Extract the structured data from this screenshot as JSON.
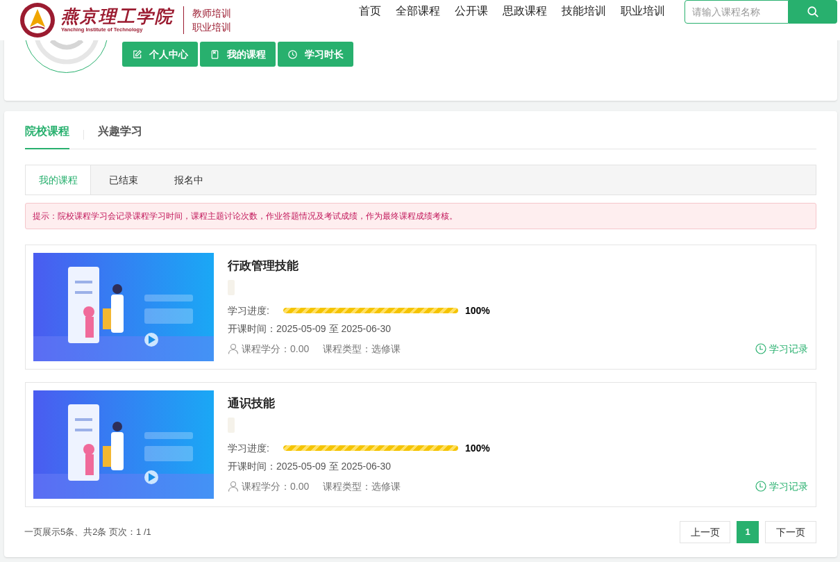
{
  "header": {
    "logo": {
      "name": "燕京理工学院",
      "subtitle": "Yanching Institute of Technology"
    },
    "site_labels": [
      "教师培训",
      "职业培训"
    ],
    "nav": [
      {
        "label": "首页",
        "selected": false
      },
      {
        "label": "全部课程",
        "selected": false
      },
      {
        "label": "公开课",
        "selected": false
      },
      {
        "label": "思政课程",
        "selected": false
      },
      {
        "label": "技能培训",
        "selected": false
      },
      {
        "label": "职业培训",
        "selected": false
      }
    ],
    "search": {
      "placeholder": "请输入课程名称"
    }
  },
  "profile": {
    "buttons": [
      {
        "label": "个人中心",
        "kind": "edit"
      },
      {
        "label": "我的课程",
        "kind": "book"
      },
      {
        "label": "学习时长",
        "kind": "clock"
      }
    ]
  },
  "tabs": [
    {
      "label": "院校课程",
      "selected": true
    },
    {
      "label": "兴趣学习",
      "selected": false
    }
  ],
  "subtabs": [
    {
      "label": "我的课程",
      "selected": true
    },
    {
      "label": "已结束",
      "selected": false
    },
    {
      "label": "报名中",
      "selected": false
    }
  ],
  "notice": "提示：院校课程学习会记录课程学习时间，课程主题讨论次数，作业答题情况及考试成绩，作为最终课程成绩考核。",
  "courses": [
    {
      "kind": "picture",
      "title": "行政管理技能",
      "progress_label": "学习进度:",
      "level": 1,
      "progress_text": "100%",
      "dates": "开课时间：2025-05-09 至 2025-06-30",
      "credits": "课程学分：0.00",
      "type": "课程类型：选修课",
      "record": "学习记录"
    },
    {
      "kind": "picture",
      "title": "通识技能",
      "progress_label": "学习进度:",
      "level": 1,
      "progress_text": "100%",
      "dates": "开课时间：2025-05-09 至 2025-06-30",
      "credits": "课程学分：0.00",
      "type": "课程类型：选修课",
      "record": "学习记录"
    }
  ],
  "pagination": {
    "summary": "一页展示5条、共2条 页次：1 /1",
    "prev": "上一页",
    "pages": [
      {
        "label": "1",
        "selected": true
      }
    ],
    "next": "下一页"
  }
}
